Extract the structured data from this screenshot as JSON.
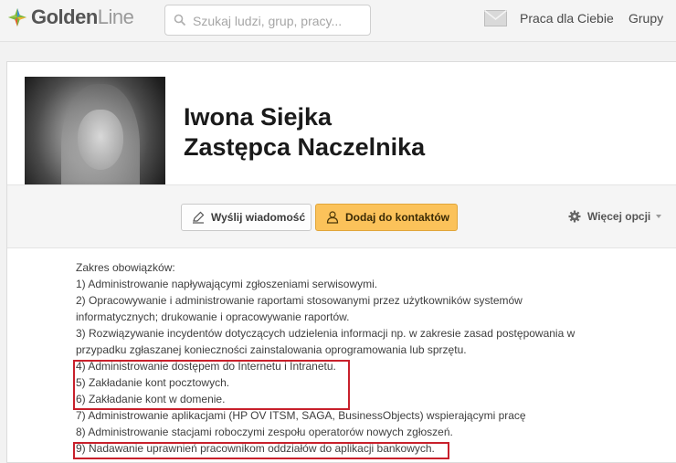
{
  "header": {
    "logo": {
      "part1": "Golden",
      "part2": "Line"
    },
    "search": {
      "placeholder": "Szukaj ludzi, grup, pracy..."
    },
    "nav": {
      "jobs": "Praca dla Ciebie",
      "groups": "Grupy"
    }
  },
  "profile": {
    "name": "Iwona Siejka",
    "title": "Zastępca Naczelnika",
    "actions": {
      "send_message": "Wyślij wiadomość",
      "add_contact": "Dodaj do kontaktów",
      "more_options": "Więcej opcji"
    },
    "duties": [
      "Zakres obowiązków:",
      "1) Administrowanie napływającymi zgłoszeniami serwisowymi.",
      "2) Opracowywanie i administrowanie raportami stosowanymi przez użytkowników systemów",
      "informatycznych; drukowanie i opracowywanie raportów.",
      "3) Rozwiązywanie incydentów dotyczących udzielenia informacji np. w zakresie zasad postępowania w",
      "przypadku zgłaszanej konieczności zainstalowania oprogramowania lub sprzętu.",
      "4) Administrowanie dostępem do Internetu i Intranetu.",
      "5) Zakładanie kont pocztowych.",
      "6) Zakładanie kont w domenie.",
      "7) Administrowanie aplikacjami (HP OV ITSM, SAGA, BusinessObjects) wspierającymi pracę",
      "8) Administrowanie stacjami roboczymi zespołu operatorów nowych zgłoszeń.",
      "9) Nadawanie uprawnień pracownikom oddziałów do aplikacji bankowych."
    ]
  },
  "colors": {
    "accent_button": "#fbc25a",
    "highlight_border": "#c8202b"
  }
}
